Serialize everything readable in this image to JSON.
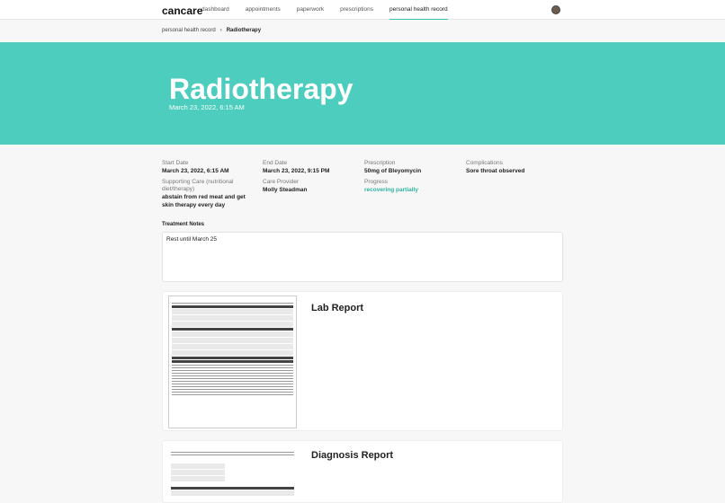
{
  "nav": {
    "brand": "cancare",
    "links": [
      "dashboard",
      "appointments",
      "paperwork",
      "prescriptions",
      "personal health record"
    ]
  },
  "breadcrumb": {
    "parent": "personal health record",
    "separator": "›",
    "current": "Radiotherapy"
  },
  "hero": {
    "title": "Radiotherapy",
    "date": "March 23, 2022, 6:15 AM",
    "color": "#4ccdbd"
  },
  "details": {
    "start_date": {
      "label": "Start Date",
      "value": "March 23, 2022, 6:15 AM"
    },
    "end_date": {
      "label": "End Date",
      "value": "March 23, 2022, 9:15 PM"
    },
    "prescription": {
      "label": "Prescription",
      "value": "50mg of Bleyomycin"
    },
    "complications": {
      "label": "Complications",
      "value": "Sore throat observed"
    },
    "supporting_care": {
      "label": "Supporting Care (nutritional diet/therapy)",
      "value": "abstain from red meat and get skin therapy every day"
    },
    "care_provider": {
      "label": "Care Provider",
      "value": "Molly Steadman"
    },
    "progress": {
      "label": "Progress",
      "value": "recovering partially"
    }
  },
  "notes": {
    "title": "Treatment Notes",
    "value": "Rest until March 25"
  },
  "reports": [
    {
      "title": "Lab Report"
    },
    {
      "title": "Diagnosis Report"
    }
  ]
}
